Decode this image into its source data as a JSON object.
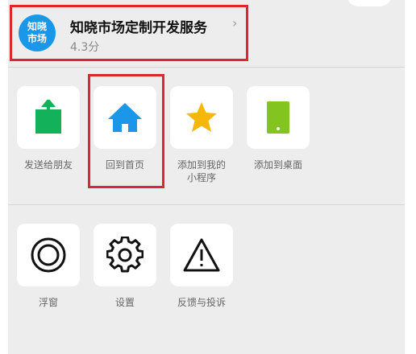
{
  "mini_program": {
    "logo_text": "知晓\n市场",
    "name": "知晓市场定制开发服务",
    "rating": "4.3分"
  },
  "share_actions": [
    {
      "label": "发送给朋友",
      "icon": "share-upload-icon",
      "color": "#13b15a"
    },
    {
      "label": "回到首页",
      "icon": "home-icon",
      "color": "#1a97e8"
    },
    {
      "label": "添加到我的\n小程序",
      "icon": "star-icon",
      "color": "#f5b70a"
    },
    {
      "label": "添加到桌面",
      "icon": "phone-icon",
      "color": "#84c421"
    }
  ],
  "tool_actions": [
    {
      "label": "浮窗",
      "icon": "floating-window-icon"
    },
    {
      "label": "设置",
      "icon": "gear-icon"
    },
    {
      "label": "反馈与投诉",
      "icon": "warning-icon"
    }
  ],
  "highlight_color": "#e0262d"
}
